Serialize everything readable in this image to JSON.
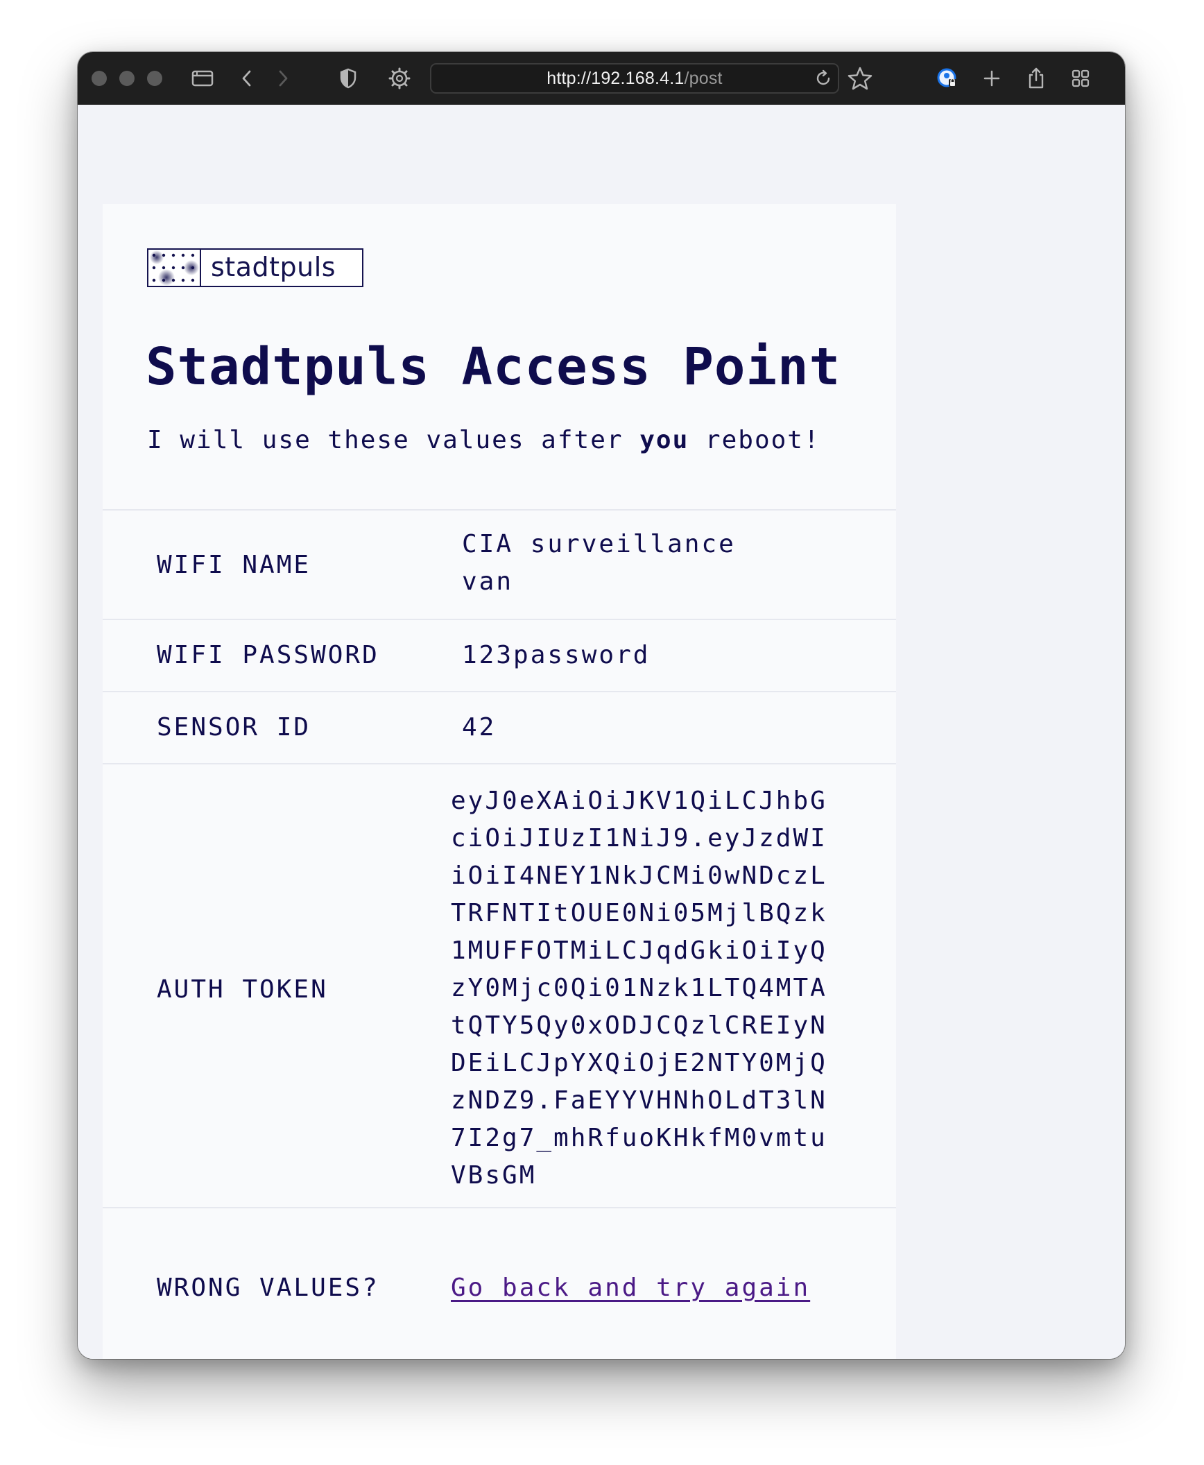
{
  "browser": {
    "url_host": "http://192.168.4.1",
    "url_path": "/post",
    "icons": [
      "sidebar-icon",
      "back-icon",
      "forward-icon",
      "shield-icon",
      "extension-icon",
      "reload-icon",
      "bookmark-star-icon",
      "profile-icon",
      "new-tab-icon",
      "share-icon",
      "tab-overview-icon"
    ]
  },
  "page": {
    "logo_text": "stadtpuls",
    "title": "Stadtpuls Access Point",
    "subtitle_before": "I will use these values after ",
    "subtitle_bold": "you",
    "subtitle_after": " reboot!"
  },
  "rows": {
    "wifi_name": {
      "label": "WIFI NAME",
      "value": "CIA surveillance van"
    },
    "wifi_password": {
      "label": "WIFI PASSWORD",
      "value": "123password"
    },
    "sensor_id": {
      "label": "SENSOR ID",
      "value": "42"
    },
    "auth_token": {
      "label": "AUTH TOKEN",
      "value": "eyJ0eXAiOiJKV1QiLCJhbGciOiJIUzI1NiJ9.eyJzdWIiOiI4NEY1NkJCMi0wNDczLTRFNTItOUE0Ni05MjlBQzk1MUFFOTMiLCJqdGkiOiIyQzY0Mjc0Qi01Nzk1LTQ4MTAtQTY5Qy0xODJCQzlCREIyNDEiLCJpYXQiOjE2NTY0MjQzNDZ9.FaEYYVHNhOLdT3lN7I2g7_mhRfuoKHkfM0vmtuVBsGM"
    },
    "wrong_values": {
      "label": "WRONG VALUES?",
      "link": "Go back and try again"
    }
  },
  "colors": {
    "ink": "#0f0c4d",
    "link": "#4b1a86",
    "page_bg": "#f2f3f8",
    "card_bg": "#f9fafc",
    "toolbar_bg": "#1f1f1f"
  }
}
